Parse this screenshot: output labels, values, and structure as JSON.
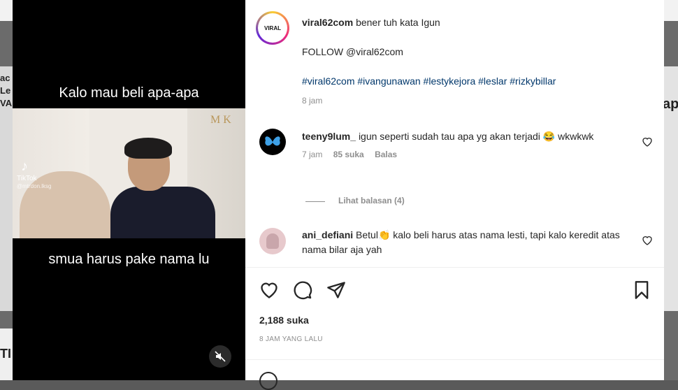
{
  "video": {
    "caption_top": "Kalo mau beli apa-apa",
    "caption_bottom": "smua harus pake nama lu",
    "watermark_brand": "TikTok",
    "watermark_user": "@mtrdon.lksg",
    "frame_logo": "M K"
  },
  "backdrop": {
    "left_text": [
      "ac",
      "Le",
      "VA",
      "TI"
    ],
    "right_text": "ap"
  },
  "post": {
    "author": "viral62com",
    "avatar_label": "VIRAL",
    "caption": "bener tuh kata Igun",
    "follow_line": "FOLLOW @viral62com",
    "hashtags": "#viral62com #ivangunawan #lestykejora #leslar #rizkybillar",
    "time": "8 jam",
    "likes": "2,188 suka",
    "time_ago": "8 JAM YANG LALU"
  },
  "comments": [
    {
      "user": "teeny9lum_",
      "text": "igun seperti sudah tau apa yg akan terjadi 😂 wkwkwk",
      "time": "7 jam",
      "likes": "85 suka",
      "reply": "Balas",
      "view_replies": "Lihat balasan (4)"
    },
    {
      "user": "ani_defiani",
      "text": "Betul👏 kalo beli harus atas nama lesti, tapi kalo keredit atas nama bilar aja yah"
    }
  ],
  "icons": {
    "like": "heart-icon",
    "comment": "comment-icon",
    "share": "share-icon",
    "save": "bookmark-icon",
    "mute": "mute-icon"
  }
}
